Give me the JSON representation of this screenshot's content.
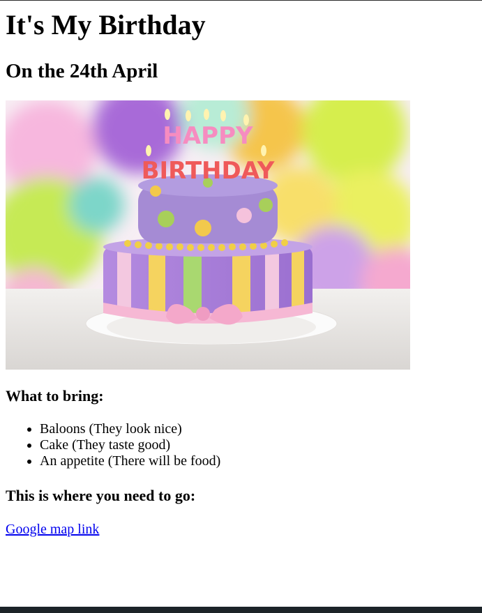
{
  "page": {
    "title": "It's My Birthday",
    "subtitle": "On the 24th April"
  },
  "photo": {
    "cake_topper_word_1": "HAPPY",
    "cake_topper_word_2": "BIRTHDAY"
  },
  "bring": {
    "heading": "What to bring:",
    "items": [
      "Baloons (They look nice)",
      "Cake (They taste good)",
      "An appetite (There will be food)"
    ]
  },
  "directions": {
    "heading": "This is where you need to go:",
    "link_label": "Google map link"
  },
  "colors": {
    "link": "#0000ee",
    "bottom_bar": "#1c2328"
  }
}
